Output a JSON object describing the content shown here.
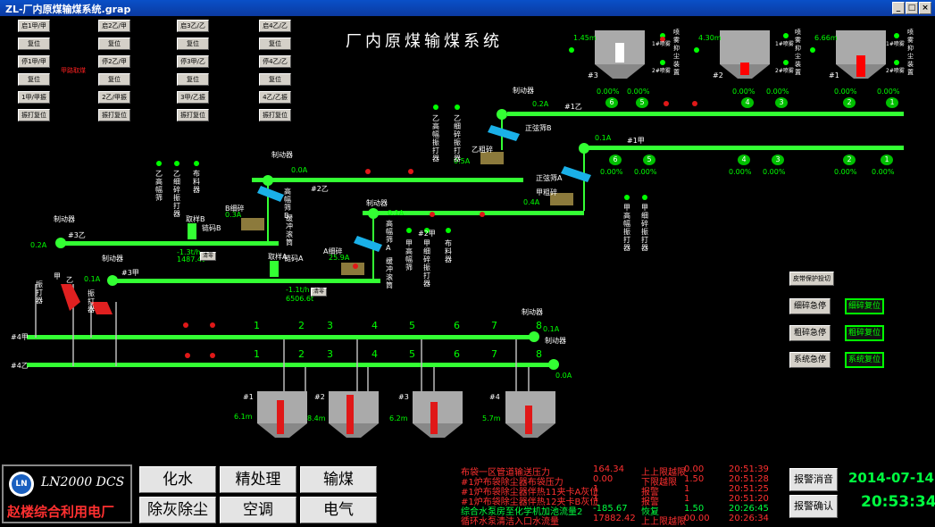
{
  "window": {
    "title": "ZL-厂内原煤输煤系统.grap",
    "min": "_",
    "max": "□",
    "close": "×"
  },
  "screen_title": "厂内原煤输煤系统",
  "control_buttons": [
    [
      "启1甲/甲",
      "启2乙/甲",
      "启3乙/乙",
      "启4乙/乙"
    ],
    [
      "复位",
      "复位",
      "复位",
      "复位"
    ],
    [
      "停1甲/甲",
      "停2乙/甲",
      "停3甲/乙",
      "停4乙/乙"
    ],
    [
      "复位",
      "复位",
      "复位",
      "复位"
    ],
    [
      "1甲/甲振打",
      "2乙/甲振打",
      "3甲/乙振打",
      "4乙/乙振打"
    ],
    [
      "振打复位",
      "振打复位",
      "振打复位",
      "振打复位"
    ]
  ],
  "warning_red": "甲路取煤",
  "bunkers_top": [
    {
      "id": "#3",
      "level": "1.45m",
      "dust1": "1#喷雾",
      "dust2": "2#喷雾",
      "sys": "喷雾抑尘装置"
    },
    {
      "id": "#2",
      "level": "4.30m",
      "dust1": "1#喷雾",
      "dust2": "2#喷雾",
      "sys": "喷雾抑尘装置"
    },
    {
      "id": "#1",
      "level": "6.66m",
      "dust1": "1#喷雾",
      "dust2": "2#喷雾",
      "sys": "喷雾抑尘装置"
    }
  ],
  "conveyors": {
    "b1z": "#1乙",
    "b1j": "#1甲",
    "b2z": "#2乙",
    "b2j": "#2甲",
    "b3z": "#3乙",
    "b3j": "#3甲",
    "b4j": "#4甲",
    "b4z": "#4乙",
    "brake": "制动器",
    "cur_1z": "0.2A",
    "cur_1j": "0.1A",
    "cur_2z": "0.0A",
    "cur_2j": "0.1A",
    "cur_3z": "0.2A",
    "cur_3j": "0.1A",
    "cur_4j": "0.1A",
    "cur_4z": "0.0A",
    "cur_eb": "0.5A",
    "cur_ea": "0.4A"
  },
  "pct_top": [
    "0.00%",
    "0.00%",
    "0.00%",
    "0.00%",
    "0.00%",
    "0.00%"
  ],
  "pct_mid": [
    "0.00%",
    "0.00%",
    "0.00%",
    "0.00%",
    "0.00%",
    "0.00%"
  ],
  "trippers_top": [
    "6",
    "5",
    "4",
    "3",
    "2",
    "1"
  ],
  "trippers_mid": [
    "6",
    "5",
    "4",
    "3",
    "2",
    "1"
  ],
  "labels": {
    "cs_b": "乙粗碎",
    "cs_a": "甲粗碎",
    "screen_b": "正弦筛B",
    "screen_a": "正弦筛A",
    "fine_b": "B细碎",
    "fine_a": "A细碎",
    "fine_b_cur": "0.3A",
    "fine_a_cur": "25.9A",
    "sampler_b": "取样B",
    "sampler_a": "取样A",
    "pulse_b": "链码B",
    "pulse_a": "链码A",
    "flow_b": "-1.3t/h",
    "total_b": "1487.4t",
    "flow_a": "-1.1t/h",
    "total_a": "6506.6t",
    "clear": "清零",
    "v_gs_b": "乙高幅筛",
    "v_fine_b": "乙细碎振打器",
    "v_coal": "布料器",
    "v_gf_b": "高幅筛B",
    "v_buf_b": "缓冲滚筒",
    "v_gf_a": "高幅筛A",
    "v_buf_a": "缓冲滚筒",
    "v_jgf": "甲高幅筛",
    "v_jfine": "甲细碎振打器",
    "v_coal2": "布料器",
    "v_b_rake": "乙高幅振打器",
    "v_b_fine": "乙细碎振打器",
    "v_a_rake": "甲高幅振打器",
    "v_a_fine": "甲细碎振打器",
    "shaker1": "振打器",
    "shaker2": "振打器",
    "jia": "甲",
    "yi": "乙"
  },
  "plows_top": [
    {
      "l": "1",
      "r": "2"
    },
    {
      "l": "3",
      "r": "4"
    },
    {
      "l": "5",
      "r": "6"
    },
    {
      "l": "7",
      "r": "8"
    }
  ],
  "plows_bot": [
    {
      "l": "1",
      "r": "2"
    },
    {
      "l": "3",
      "r": "4"
    },
    {
      "l": "5",
      "r": "6"
    },
    {
      "l": "7",
      "r": "8"
    }
  ],
  "bunkers_bottom": [
    {
      "id": "#1",
      "level": "6.1m"
    },
    {
      "id": "#2",
      "level": "8.4m"
    },
    {
      "id": "#3",
      "level": "6.2m"
    },
    {
      "id": "#4",
      "level": "5.7m"
    }
  ],
  "system_buttons": {
    "protect": "皮带保护投切",
    "fine_stop": "细碎急停",
    "fine_reset": "细碎复位",
    "coarse_stop": "粗碎急停",
    "coarse_reset": "粗碎复位",
    "sys_stop": "系统急停",
    "sys_reset": "系统复位"
  },
  "bottom": {
    "brand": "LN2000 DCS",
    "company": "赵楼综合利用电厂",
    "logo": "LN",
    "nav": [
      "化水",
      "精处理",
      "输煤",
      "除灰除尘",
      "空调",
      "电气"
    ],
    "alarms": [
      {
        "desc": "布袋一区管道输送压力",
        "val": "164.34",
        "type": "上上限越限",
        "lim": "0.00",
        "time": "20:51:39"
      },
      {
        "desc": "#1炉布袋除尘器布袋压力",
        "val": "0.00",
        "type": "下限越限",
        "lim": "1.50",
        "time": "20:51:28"
      },
      {
        "desc": "#1炉布袋除尘器伴热11夹卡A灰位",
        "val": "1",
        "type": "报警",
        "lim": "1",
        "time": "20:51:25"
      },
      {
        "desc": "#1炉布袋除尘器伴热12夹卡B灰位",
        "val": "1",
        "type": "报警",
        "lim": "1",
        "time": "20:51:20"
      },
      {
        "desc": "综合水泵房至化学机加池流量2",
        "val": "-185.67",
        "type": "恢复",
        "lim": "1.50",
        "time": "20:26:45"
      },
      {
        "desc": "循环水泵清洁入口水流量",
        "val": "17882.42",
        "type": "上上限越限",
        "lim": "00.00",
        "time": "20:26:34"
      }
    ],
    "alarm_ack": "报警消音",
    "alarm_confirm": "报警确认",
    "date": "2014-07-14",
    "time": "20:53:34"
  },
  "colors": {
    "belt": "#33ff33",
    "alarm": "#ff2020",
    "ok": "#00ff00"
  }
}
